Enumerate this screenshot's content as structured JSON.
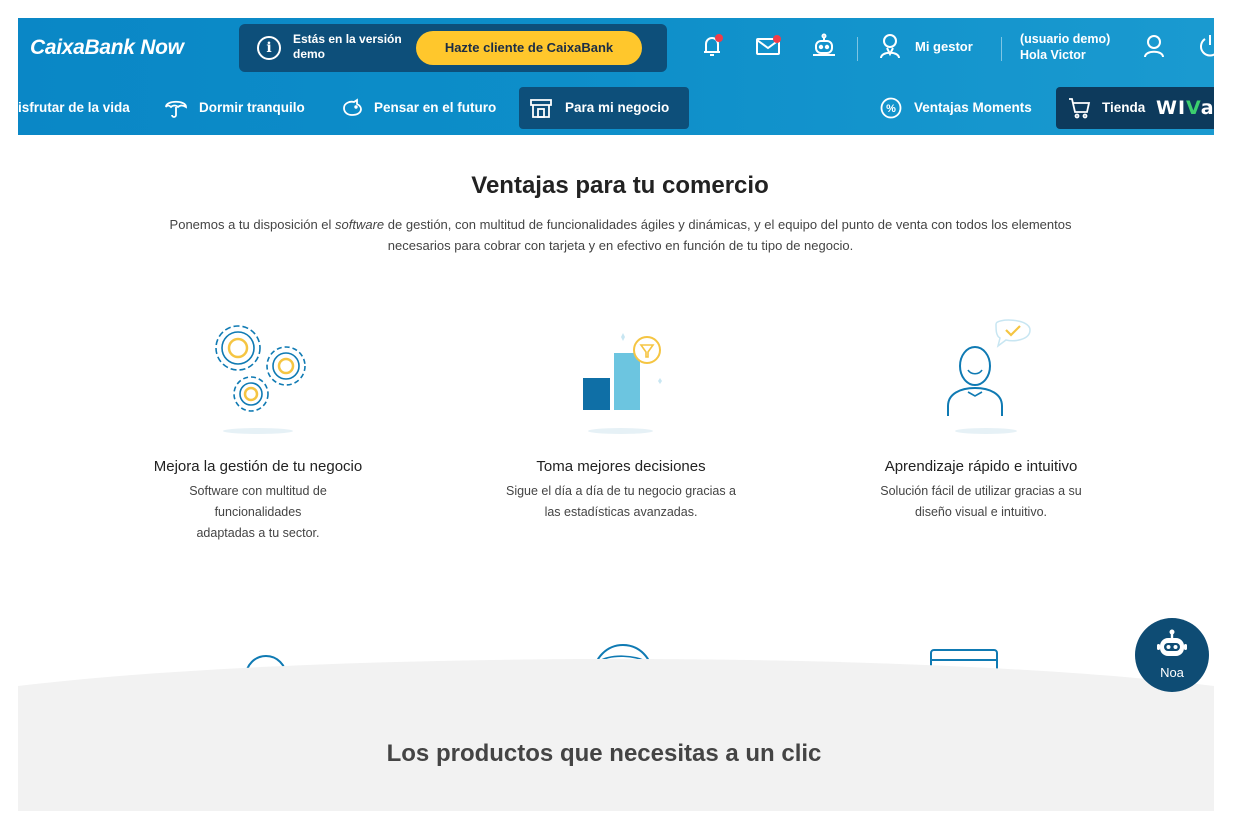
{
  "header": {
    "logo": "CaixaBank Now",
    "demo_notice": "Estás en la versión demo",
    "client_button": "Hazte cliente de CaixaBank",
    "gestor_label": "Mi gestor",
    "user_line1": "(usuario demo)",
    "user_line2": "Hola Victor",
    "icons": [
      "info-icon",
      "bell-icon",
      "mail-icon",
      "robot-icon",
      "advisor-icon",
      "user-icon",
      "power-icon"
    ],
    "notification_color": "#ef3d4a",
    "accent_yellow": "#ffc72c",
    "brand_blue": "#0a87c6"
  },
  "nav": {
    "items": [
      {
        "label": "isfrutar de la vida",
        "icon": ""
      },
      {
        "label": "Dormir tranquilo",
        "icon": "umbrella-icon"
      },
      {
        "label": "Pensar en el futuro",
        "icon": "piggy-bank-icon"
      },
      {
        "label": "Para mi negocio",
        "icon": "store-icon",
        "active": true
      },
      {
        "label": "Ventajas Moments",
        "icon": "percent-icon"
      }
    ],
    "tienda_label": "Tienda",
    "wiva_prefix": "WI",
    "wiva_v": "V",
    "wiva_suffix": "a"
  },
  "content": {
    "title": "Ventajas para tu comercio",
    "intro_before": "Ponemos a tu disposición el ",
    "intro_em": "software",
    "intro_after": " de gestión, con multitud de funcionalidades ágiles y dinámicas, y el equipo del punto de venta con todos los elementos necesarios para cobrar con tarjeta y en efectivo en función de tu tipo de negocio.",
    "features": [
      {
        "title": "Mejora la gestión de tu negocio",
        "line1": "Software con multitud de",
        "line2": "funcionalidades",
        "line3": "adaptadas a tu sector.",
        "icon": "gears-icon"
      },
      {
        "title": "Toma mejores decisiones",
        "line1": "Sigue el día a día de tu negocio gracias a",
        "line2": "las estadísticas avanzadas.",
        "icon": "bar-chart-icon"
      },
      {
        "title": "Aprendizaje rápido e intuitivo",
        "line1": "Solución fácil de utilizar gracias a su",
        "line2": "diseño visual e intuitivo.",
        "icon": "person-icon"
      }
    ]
  },
  "bottom": {
    "title": "Los productos que necesitas a un clic"
  },
  "assistant": {
    "label": "Noa"
  }
}
